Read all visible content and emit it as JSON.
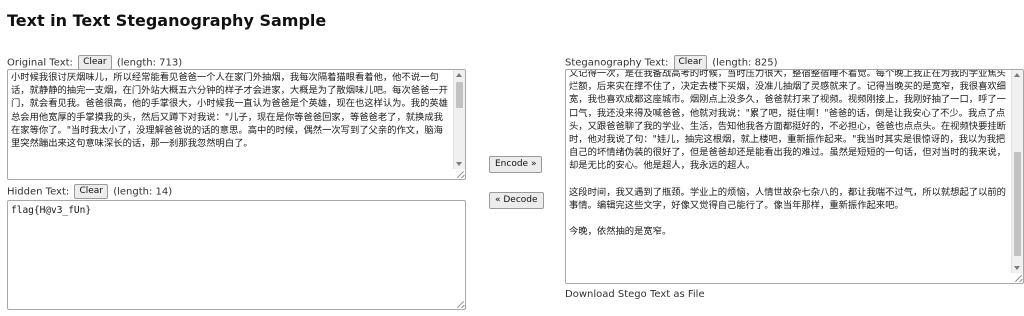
{
  "page": {
    "title": "Text in Text Steganography Sample"
  },
  "original": {
    "label": "Original Text:",
    "clear_label": "Clear",
    "length_text": "(length: 713)",
    "text": "小时候我很讨厌烟味儿，所以经常能看见爸爸一个人在家门外抽烟，我每次隔着猫眼看着他，他不说一句话，就静静的抽完一支烟，在门外站大概五六分钟的样子才会进家，大概是为了散烟味儿吧。每次爸爸一开门，就会看见我。爸爸很高，他的手掌很大，小时候我一直认为爸爸是个英雄，现在也这样认为。我的英雄总会用他宽厚的手掌摸我的头，然后又蹲下对我说：\"儿子，现在是你等爸爸回家，等爸爸老了，就换成我在家等你了。\"当时我太小了，没理解爸爸说的话的意思。高中的时候，偶然一次写到了父亲的作文，脑海里突然蹦出来这句意味深长的话，那一刹那我忽然明白了。"
  },
  "hidden": {
    "label": "Hidden Text:",
    "clear_label": "Clear",
    "length_text": "(length: 14)",
    "text": "flag{H@v3_fUn}"
  },
  "actions": {
    "encode_label": "Encode »",
    "decode_label": "« Decode"
  },
  "stego": {
    "label": "Steganography Text:",
    "clear_label": "Clear",
    "length_text": "(length: 825)",
    "text": "又记得一次，是在我备战高考的时候，当时压力很大，整宿整宿睡不着觉。每个晚上我正在为我的学业焦头烂额，后来实在撑不住了，决定去楼下买烟，没准儿抽烟了灵感就来了。记得当晚买的是宽窄，我很喜欢细宽，我也喜欢成都这座城市。烟刚点上没多久，爸爸就打来了视频。视频刚接上，我刚好抽了一口，呼了一口气，我还没来得及喊爸爸，他就对我说：\"累了吧，挺住啊！\"爸爸的话，倒是让我安心了不少。我点了点头，又跟爸爸聊了我的学业、生活，告知他我各方面都挺好的，不必担心，爸爸也点点头。在视频快要挂断时，他对我说了句：\"娃儿，抽完这根烟，就上楼吧，重新振作起来。\"我当时其实是很惊讶的，我以为我把自己的坏情绪伪装的很好了，但是爸爸却还是能看出我的难过。虽然是短短的一句话，但对当时的我来说，却是无比的安心。他是超人，我永远的超人。\n\n这段时间，我又遇到了瓶颈。学业上的烦恼，人情世故杂七杂八的，都让我喘不过气，所以就想起了以前的事情。编辑完这些文字，好像又觉得自己能行了。像当年那样，重新振作起来吧。\n\n今晚，依然抽的是宽窄。"
  },
  "download": {
    "label": "Download Stego Text as File"
  },
  "icons": {
    "scroll_up": "scroll-up-arrow-icon",
    "scroll_down": "scroll-down-arrow-icon",
    "resize": "resize-grip-icon"
  }
}
